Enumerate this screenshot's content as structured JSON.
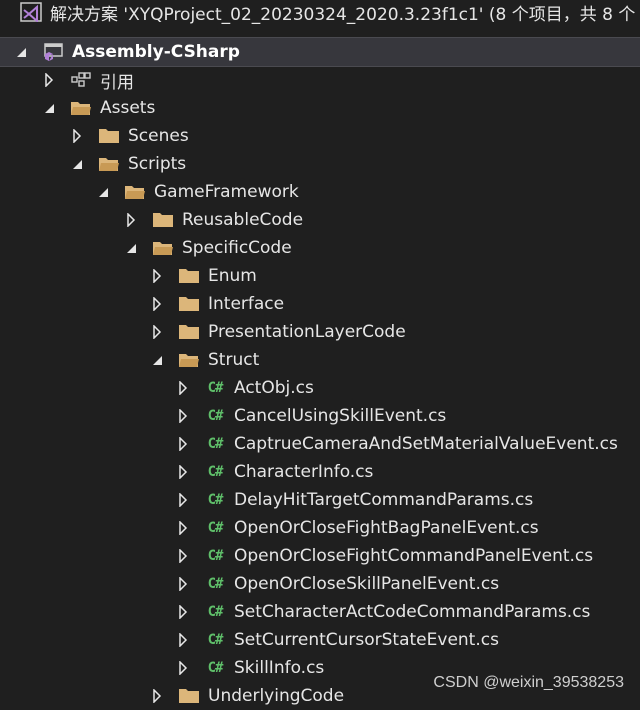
{
  "solution": {
    "label": "解决方案 'XYQProject_02_20230324_2020.3.23f1c1' (8 个项目，共 8 个"
  },
  "project": {
    "label": "Assembly-CSharp"
  },
  "nodes": {
    "references": "引用",
    "assets": "Assets",
    "scenes": "Scenes",
    "scripts": "Scripts",
    "game_framework": "GameFramework",
    "reusable_code": "ReusableCode",
    "specific_code": "SpecificCode",
    "enum": "Enum",
    "interface": "Interface",
    "presentation_layer_code": "PresentationLayerCode",
    "struct": "Struct",
    "underlying_code": "UnderlyingCode"
  },
  "cs_badge": "C#",
  "files": [
    "ActObj.cs",
    "CancelUsingSkillEvent.cs",
    "CaptrueCameraAndSetMaterialValueEvent.cs",
    "CharacterInfo.cs",
    "DelayHitTargetCommandParams.cs",
    "OpenOrCloseFightBagPanelEvent.cs",
    "OpenOrCloseFightCommandPanelEvent.cs",
    "OpenOrCloseSkillPanelEvent.cs",
    "SetCharacterActCodeCommandParams.cs",
    "SetCurrentCursorStateEvent.cs",
    "SkillInfo.cs"
  ],
  "watermark": "CSDN @weixin_39538253",
  "colors": {
    "background": "#1f1f1f",
    "folder": "#dcb67a",
    "csharp": "#5fbf6a",
    "vs_purple": "#b180d7"
  }
}
